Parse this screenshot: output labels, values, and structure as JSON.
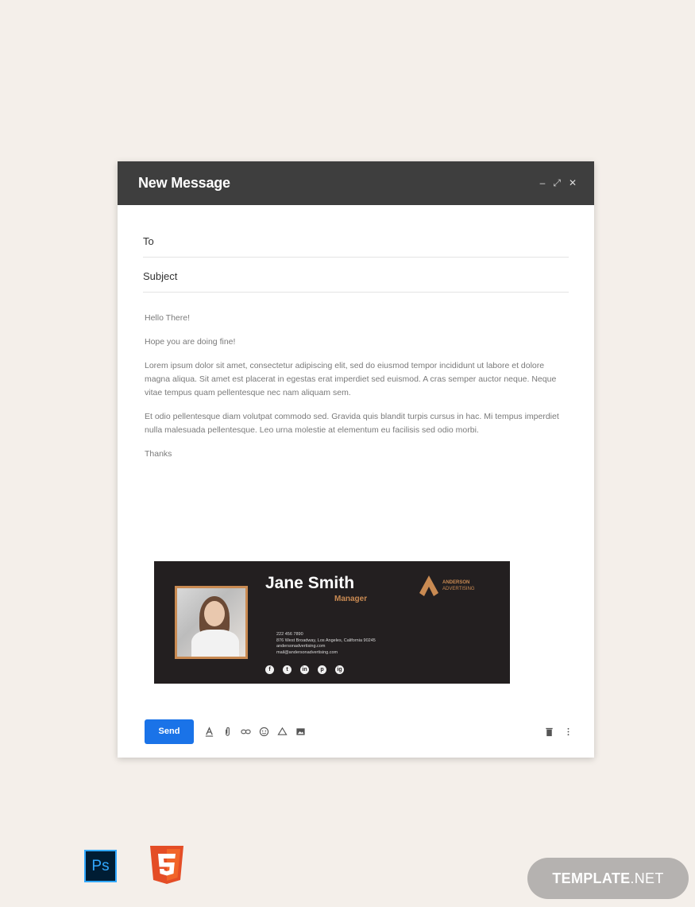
{
  "compose": {
    "title": "New Message",
    "to_label": "To",
    "subject_label": "Subject",
    "body": {
      "greeting": "Hello There!",
      "line1": "Hope you are doing fine!",
      "para1": "Lorem ipsum dolor sit amet, consectetur adipiscing elit, sed do eiusmod tempor incididunt ut labore et dolore magna aliqua. Sit amet est placerat in egestas erat imperdiet sed euismod. A cras semper auctor neque. Neque vitae tempus quam pellentesque nec nam aliquam sem.",
      "para2": "Et odio pellentesque diam volutpat commodo sed. Gravida quis blandit turpis cursus in hac. Mi tempus imperdiet nulla malesuada pellentesque. Leo urna molestie at elementum eu facilisis sed odio morbi.",
      "closing": "Thanks"
    },
    "send_label": "Send"
  },
  "signature": {
    "name": "Jane Smith",
    "role": "Manager",
    "company": "ANDERSON",
    "company_sub": "ADVERTISING",
    "phone": "222 456 7890",
    "address": "876 West Broadway, Los Angeles, California 90245",
    "website": "andersonadvertising.com",
    "email": "mail@andersonadvertising.com",
    "socials": [
      "f",
      "t",
      "in",
      "p",
      "ig"
    ]
  },
  "footer": {
    "ps_badge": "Ps",
    "brand_main": "TEMPLATE",
    "brand_suffix": ".NET"
  },
  "colors": {
    "accent": "#c98a52",
    "send": "#1a73e8",
    "signature_bg": "#231f20"
  }
}
